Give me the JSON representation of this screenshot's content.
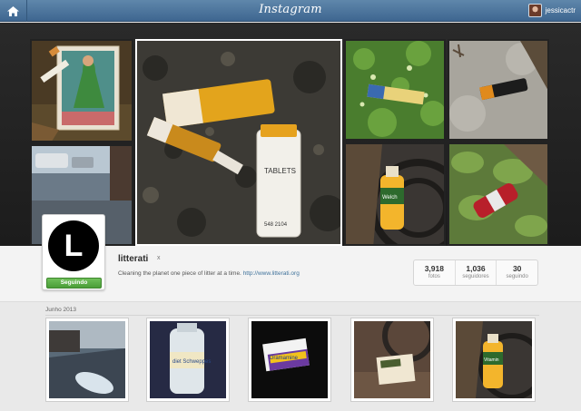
{
  "header": {
    "brand": "Instagram",
    "username": "jessicactr"
  },
  "profile": {
    "username": "litterati",
    "badge": "x",
    "bio_text": "Cleaning the planet one piece of litter at a time.",
    "bio_link": "http://www.litterati.org",
    "follow_label": "Seguindo",
    "avatar_letter": "L"
  },
  "stats": [
    {
      "value": "3,918",
      "label": "fotos"
    },
    {
      "value": "1,036",
      "label": "seguidores"
    },
    {
      "value": "30",
      "label": "seguindo"
    }
  ],
  "feed": {
    "month_label": "Junho 2013"
  },
  "hero_labels": {
    "pill_text": "TABLETS",
    "pill_num": "548 2104",
    "bottle_label": "Welch"
  },
  "thumb_labels": {
    "diet": "diet Schweppes",
    "brand": "Dramamine",
    "bottle": "Vitamin"
  },
  "colors": {
    "topbar": "#4a7199",
    "follow_green": "#5aad45",
    "link_blue": "#3f729b"
  }
}
